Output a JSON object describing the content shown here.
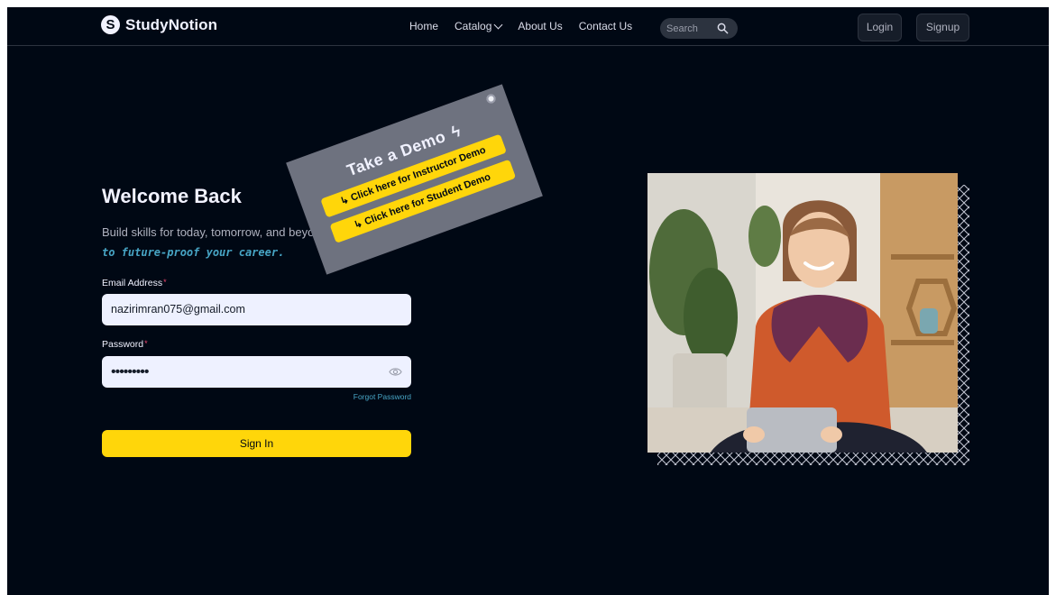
{
  "brand": {
    "logo_letter": "S",
    "name": "StudyNotion"
  },
  "nav": {
    "links": [
      "Home",
      "Catalog",
      "About Us",
      "Contact Us"
    ],
    "search_label": "Search",
    "login_label": "Login",
    "signup_label": "Signup"
  },
  "login": {
    "title": "Welcome Back",
    "description": "Build skills for today, tomorrow, and beyond.",
    "description_accent": "to future-proof your career.",
    "email_label": "Email Address",
    "email_value": "nazirimran075@gmail.com",
    "password_label": "Password",
    "password_value": "•••••••••",
    "required_mark": "*",
    "forgot_label": "Forgot Password",
    "signin_label": "Sign In"
  },
  "demo": {
    "title": "Take a Demo",
    "instructor_label": "↳ Click here for Instructor Demo",
    "student_label": "↳ Click here for Student Demo"
  },
  "colors": {
    "background": "#000814",
    "accent_yellow": "#ffd60a",
    "accent_blue": "#47a5c5",
    "input_bg": "#eef1ff"
  },
  "icons": [
    "search-icon",
    "chevron-down-icon",
    "eye-icon",
    "lightning-icon",
    "pin-icon"
  ]
}
